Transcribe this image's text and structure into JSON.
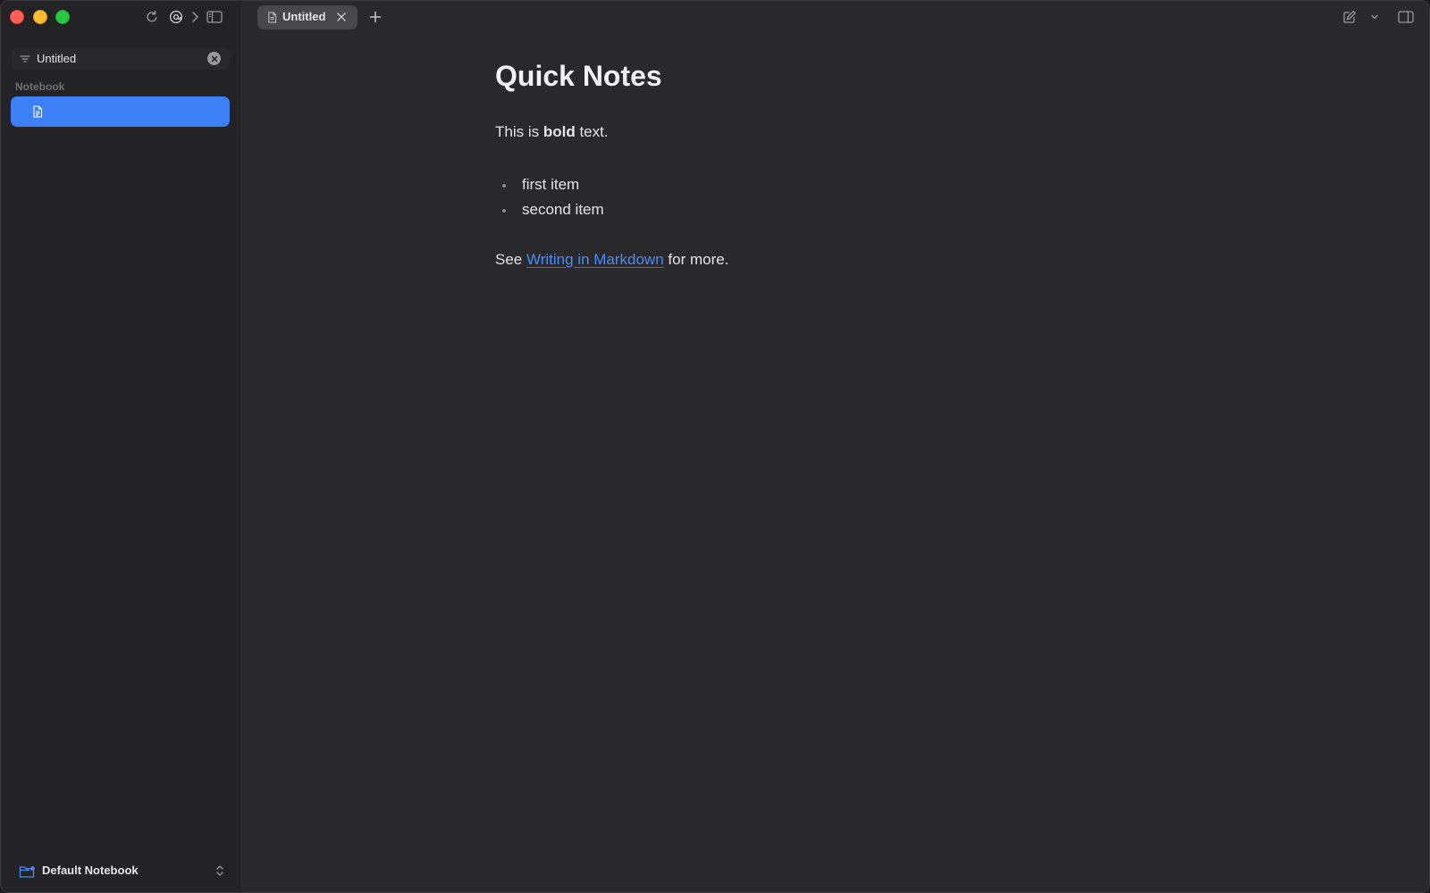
{
  "window": {
    "buttons": [
      "close",
      "minimize",
      "zoom"
    ]
  },
  "toolbar": {
    "icons": [
      "refresh-icon",
      "at-sign-icon",
      "chevron-right-icon",
      "sidebar-toggle-icon",
      "compose-icon",
      "chevron-down-icon",
      "right-panel-icon"
    ]
  },
  "sidebar": {
    "filter": {
      "value": "Untitled"
    },
    "section_label": "Notebook",
    "notes": [
      {
        "title": "",
        "selected": true
      }
    ],
    "notebook_picker": {
      "label": "Default Notebook"
    }
  },
  "tabs": [
    {
      "label": "Untitled",
      "active": true
    }
  ],
  "editor": {
    "heading": "Quick Notes",
    "p1": {
      "before": "This is ",
      "bold": "bold",
      "after": " text."
    },
    "list": [
      "first item",
      "second item"
    ],
    "p2": {
      "before": "See ",
      "link": "Writing in Markdown",
      "after": " for more."
    }
  },
  "colors": {
    "accent": "#3c7ef4",
    "link": "#4a8cf7",
    "background": "#29282a",
    "sidebar": "#232224"
  }
}
